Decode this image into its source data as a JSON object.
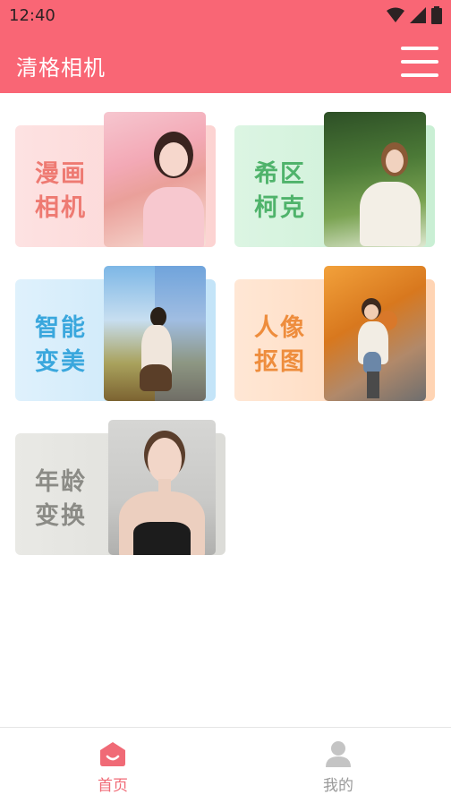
{
  "status_bar": {
    "time": "12:40",
    "icons": [
      "wifi-icon",
      "signal-icon",
      "battery-icon"
    ]
  },
  "app_bar": {
    "title": "清格相机",
    "menu_icon": "hamburger-menu-icon"
  },
  "features": [
    {
      "line1": "漫画",
      "line2": "相机",
      "color": "#ee7a72"
    },
    {
      "line1": "希区",
      "line2": "柯克",
      "color": "#4fb36b"
    },
    {
      "line1": "智能",
      "line2": "变美",
      "color": "#3aa7dd"
    },
    {
      "line1": "人像",
      "line2": "抠图",
      "color": "#ee8d3d"
    },
    {
      "line1": "年龄",
      "line2": "变换",
      "color": "#8b8b86"
    }
  ],
  "bottom_nav": {
    "home_label": "首页",
    "mine_label": "我的",
    "active_color": "#f06a76",
    "inactive_color": "#9a9a9a"
  },
  "colors": {
    "primary": "#f96675"
  }
}
